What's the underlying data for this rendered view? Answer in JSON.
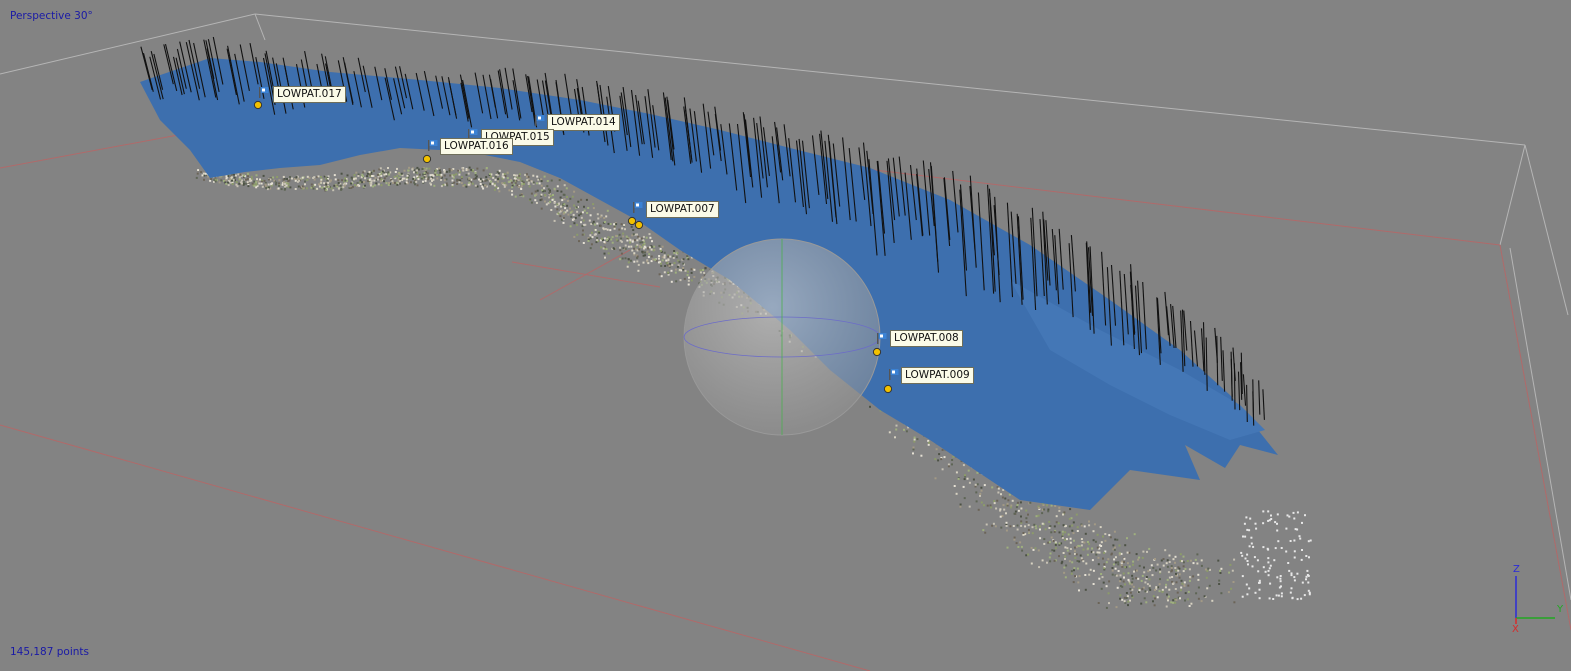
{
  "viewport": {
    "view_mode": "Perspective 30°",
    "point_count": "145,187 points"
  },
  "markers": [
    {
      "label": "LOWPAT.017"
    },
    {
      "label": "LOWPAT.014"
    },
    {
      "label": "LOWPAT.015"
    },
    {
      "label": "LOWPAT.016"
    },
    {
      "label": "LOWPAT.007"
    },
    {
      "label": "LOWPAT.008"
    },
    {
      "label": "LOWPAT.009"
    }
  ],
  "axes": {
    "z": "Z",
    "y": "Y",
    "x": "X"
  },
  "colors": {
    "background": "#838383",
    "grid_box": "#b7b7b7",
    "grid_red": "#b46a6a",
    "surface": "#3d6fae",
    "camera_line": "#111111",
    "marker_point": "#f2c100",
    "overlay_text": "#1a1aa6"
  },
  "icons": {
    "marker_flag": "flag-icon",
    "marker_point": "marker-dot-icon",
    "navigation_sphere": "trackball-sphere",
    "axis_gizmo": "axis-triad-icon"
  }
}
